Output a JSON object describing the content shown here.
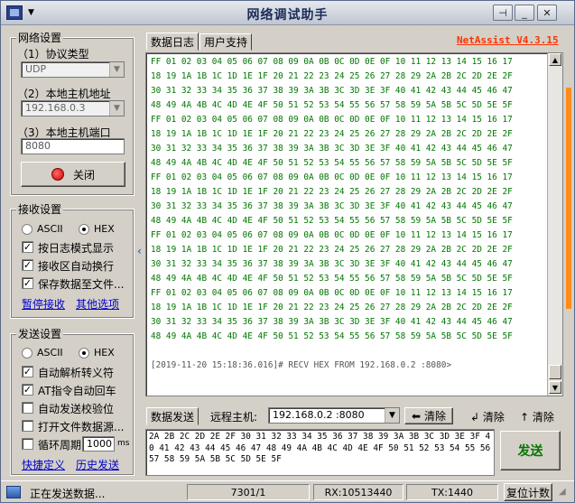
{
  "window": {
    "title": "网络调试助手",
    "pin_icon": "pin-icon",
    "version": "NetAssist V4.3.15"
  },
  "net_settings": {
    "group_title": "网络设置",
    "protocol_label": "（1）协议类型",
    "protocol_value": "UDP",
    "host_label": "（2）本地主机地址",
    "host_value": "192.168.0.3",
    "port_label": "（3）本地主机端口",
    "port_value": "8080",
    "close_button": "关闭"
  },
  "recv_settings": {
    "group_title": "接收设置",
    "ascii": "ASCII",
    "hex": "HEX",
    "opt_log_mode": "按日志模式显示",
    "opt_auto_wrap": "接收区自动换行",
    "opt_save_file": "保存数据至文件...",
    "link_pause": "暂停接收",
    "link_other": "其他选项"
  },
  "send_settings": {
    "group_title": "发送设置",
    "ascii": "ASCII",
    "hex": "HEX",
    "opt_auto_escape": "自动解析转义符",
    "opt_at_crlf": "AT指令自动回车",
    "opt_checksum": "自动发送校验位",
    "opt_open_file": "打开文件数据源...",
    "opt_cycle": "循环周期",
    "cycle_value": "1000",
    "cycle_unit": "ms",
    "link_shortcut": "快捷定义",
    "link_history": "历史发送"
  },
  "tabs": {
    "log": "数据日志",
    "support": "用户支持"
  },
  "recv": {
    "lines": [
      "FF 01 02 03 04 05 06 07 08 09 0A 0B 0C 0D 0E 0F 10 11 12 13 14 15 16 17",
      "18 19 1A 1B 1C 1D 1E 1F 20 21 22 23 24 25 26 27 28 29 2A 2B 2C 2D 2E 2F",
      "30 31 32 33 34 35 36 37 38 39 3A 3B 3C 3D 3E 3F 40 41 42 43 44 45 46 47",
      "48 49 4A 4B 4C 4D 4E 4F 50 51 52 53 54 55 56 57 58 59 5A 5B 5C 5D 5E 5F",
      "FF 01 02 03 04 05 06 07 08 09 0A 0B 0C 0D 0E 0F 10 11 12 13 14 15 16 17",
      "18 19 1A 1B 1C 1D 1E 1F 20 21 22 23 24 25 26 27 28 29 2A 2B 2C 2D 2E 2F",
      "30 31 32 33 34 35 36 37 38 39 3A 3B 3C 3D 3E 3F 40 41 42 43 44 45 46 47",
      "48 49 4A 4B 4C 4D 4E 4F 50 51 52 53 54 55 56 57 58 59 5A 5B 5C 5D 5E 5F",
      "FF 01 02 03 04 05 06 07 08 09 0A 0B 0C 0D 0E 0F 10 11 12 13 14 15 16 17",
      "18 19 1A 1B 1C 1D 1E 1F 20 21 22 23 24 25 26 27 28 29 2A 2B 2C 2D 2E 2F",
      "30 31 32 33 34 35 36 37 38 39 3A 3B 3C 3D 3E 3F 40 41 42 43 44 45 46 47",
      "48 49 4A 4B 4C 4D 4E 4F 50 51 52 53 54 55 56 57 58 59 5A 5B 5C 5D 5E 5F",
      "FF 01 02 03 04 05 06 07 08 09 0A 0B 0C 0D 0E 0F 10 11 12 13 14 15 16 17",
      "18 19 1A 1B 1C 1D 1E 1F 20 21 22 23 24 25 26 27 28 29 2A 2B 2C 2D 2E 2F",
      "30 31 32 33 34 35 36 37 38 39 3A 3B 3C 3D 3E 3F 40 41 42 43 44 45 46 47",
      "48 49 4A 4B 4C 4D 4E 4F 50 51 52 53 54 55 56 57 58 59 5A 5B 5C 5D 5E 5F",
      "FF 01 02 03 04 05 06 07 08 09 0A 0B 0C 0D 0E 0F 10 11 12 13 14 15 16 17",
      "18 19 1A 1B 1C 1D 1E 1F 20 21 22 23 24 25 26 27 28 29 2A 2B 2C 2D 2E 2F",
      "30 31 32 33 34 35 36 37 38 39 3A 3B 3C 3D 3E 3F 40 41 42 43 44 45 46 47",
      "48 49 4A 4B 4C 4D 4E 4F 50 51 52 53 54 55 56 57 58 59 5A 5B 5C 5D 5E 5F"
    ],
    "log_line": "[2019-11-20 15:18:36.016]# RECV HEX FROM 192.168.0.2 :8080>"
  },
  "send_bar": {
    "label": "数据发送",
    "remote_label": "远程主机:",
    "remote_value": "192.168.0.2 :8080",
    "clear1": "清除",
    "clear2": "清除",
    "clear3": "清除",
    "content": "2A 2B 2C 2D 2E 2F 30 31 32 33 34 35 36 37 38 39 3A 3B 3C 3D 3E 3F 40 41 42 43 44 45 46 47 48 49 4A 4B 4C 4D 4E 4F 50 51 52 53 54 55 56 57 58 59 5A 5B 5C 5D 5E 5F",
    "send_button": "发送"
  },
  "status": {
    "sending": "正在发送数据...",
    "counter": "7301/1",
    "rx": "RX:10513440",
    "tx": "TX:1440",
    "reset": "复位计数"
  },
  "colors": {
    "hex_text": "#007700",
    "version": "#ff3300",
    "link": "#0000cc",
    "accent_bar": "#ff8c1a"
  }
}
